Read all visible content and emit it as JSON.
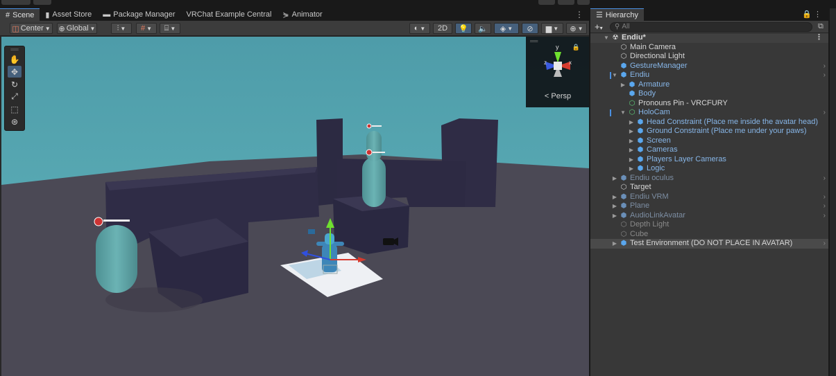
{
  "scene_tabs": [
    {
      "label": "Scene",
      "icon": "grid-icon",
      "active": true
    },
    {
      "label": "Asset Store",
      "icon": "bag-icon"
    },
    {
      "label": "Package Manager",
      "icon": "package-icon"
    },
    {
      "label": "VRChat Example Central",
      "icon": ""
    },
    {
      "label": "Animator",
      "icon": "animator-icon"
    }
  ],
  "toolbar": {
    "pivot_label": "Center",
    "space_label": "Global",
    "mode_2d_label": "2D"
  },
  "gizmo": {
    "persp_label": "Persp",
    "y_axis": "y",
    "x_axis": "x",
    "z_axis": "z"
  },
  "hierarchy": {
    "tab_label": "Hierarchy",
    "search_placeholder": "All",
    "items": [
      {
        "label": "Endiu*",
        "depth": 0,
        "fold": "open",
        "kind": "root"
      },
      {
        "label": "Main Camera",
        "depth": 1,
        "fold": "none",
        "kind": "normal"
      },
      {
        "label": "Directional Light",
        "depth": 1,
        "fold": "none",
        "kind": "normal"
      },
      {
        "label": "GestureManager",
        "depth": 1,
        "fold": "none",
        "kind": "blue",
        "arrow": true
      },
      {
        "label": "Endiu",
        "depth": 1,
        "fold": "open",
        "kind": "blue",
        "arrow": true,
        "mark": true
      },
      {
        "label": "Armature",
        "depth": 2,
        "fold": "closed",
        "kind": "blue"
      },
      {
        "label": "Body",
        "depth": 2,
        "fold": "none",
        "kind": "blue"
      },
      {
        "label": "Pronouns Pin - VRCFURY",
        "depth": 2,
        "fold": "none",
        "kind": "normal",
        "icon": "green"
      },
      {
        "label": "HoloCam",
        "depth": 2,
        "fold": "open",
        "kind": "blue",
        "arrow": true,
        "mark": true,
        "icon": "green"
      },
      {
        "label": "Head Constraint (Place me inside the avatar head)",
        "depth": 3,
        "fold": "closed",
        "kind": "blue"
      },
      {
        "label": "Ground Constraint (Place me under your paws)",
        "depth": 3,
        "fold": "closed",
        "kind": "blue"
      },
      {
        "label": "Screen",
        "depth": 3,
        "fold": "closed",
        "kind": "blue"
      },
      {
        "label": "Cameras",
        "depth": 3,
        "fold": "closed",
        "kind": "blue"
      },
      {
        "label": "Players Layer Cameras",
        "depth": 3,
        "fold": "closed",
        "kind": "blue"
      },
      {
        "label": "Logic",
        "depth": 3,
        "fold": "closed",
        "kind": "blue"
      },
      {
        "label": "Endiu oculus",
        "depth": 1,
        "fold": "closed",
        "kind": "dim",
        "arrow": true
      },
      {
        "label": "Target",
        "depth": 1,
        "fold": "none",
        "kind": "normal"
      },
      {
        "label": "Endiu VRM",
        "depth": 1,
        "fold": "closed",
        "kind": "dim",
        "arrow": true
      },
      {
        "label": "Plane",
        "depth": 1,
        "fold": "closed",
        "kind": "dim",
        "arrow": true
      },
      {
        "label": "AudioLinkAvatar",
        "depth": 1,
        "fold": "closed",
        "kind": "dim",
        "arrow": true
      },
      {
        "label": "Depth Light",
        "depth": 1,
        "fold": "none",
        "kind": "dim2"
      },
      {
        "label": "Cube",
        "depth": 1,
        "fold": "none",
        "kind": "dim2"
      },
      {
        "label": "Test Environment (DO NOT PLACE IN AVATAR)",
        "depth": 1,
        "fold": "closed",
        "kind": "sel",
        "arrow": true
      }
    ]
  },
  "colors": {
    "sky": "#56a7b3",
    "ground": "#4c4a55",
    "box": "#2e2c45",
    "capsule": "#5fa6a8",
    "accent": "#4a90e2"
  }
}
